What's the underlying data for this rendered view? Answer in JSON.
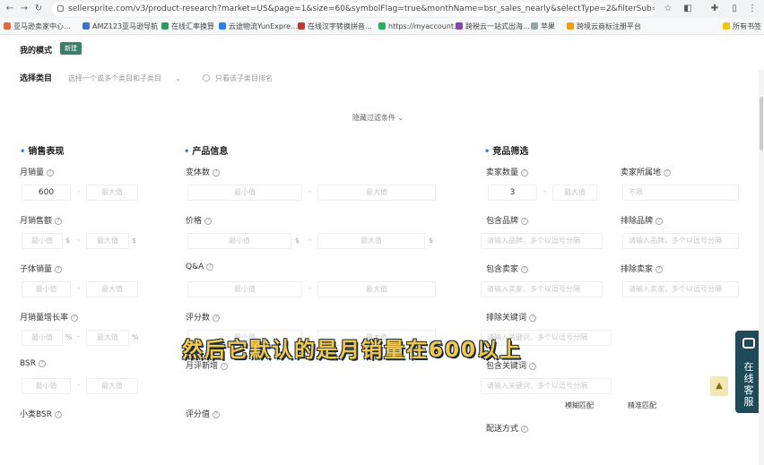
{
  "browser": {
    "url": "sellersprite.com/v3/product-research?market=US&page=1&size=60&symbolFlag=true&monthName=bsr_sales_nearly&selectType=2&filterSub=false&weightUnit=...",
    "all_bookmarks": "所有书签",
    "bookmarks": [
      "亚马逊卖家中心…",
      "AMZ123亚马逊导航",
      "在线汇率换算",
      "云途物流YunExpre…",
      "在线汉字转换拼音…",
      "https://myaccount…",
      "跨税云一站式出海…",
      "苹果",
      "跨境云商标注册平台"
    ]
  },
  "filters": {
    "mode_label": "我的模式",
    "mode_badge": "新建",
    "category_label": "选择类目",
    "category_placeholder": "选择一个或多个类目和子类目",
    "subcategory_label": "只看该子类目排名",
    "hide_filters": "隐藏过滤条件"
  },
  "sections": {
    "sales": "销售表现",
    "product": "产品信息",
    "competition": "竞品筛选"
  },
  "fields": {
    "monthly_sales": "月销量",
    "monthly_revenue": "月销售额",
    "variant_sales": "子体销量",
    "sales_growth": "月销量增长率",
    "bsr": "BSR",
    "sub_bsr": "小类BSR",
    "variant_count": "变体数",
    "price": "价格",
    "qa": "Q&A",
    "rating_count": "评分数",
    "monthly_new_reviews": "月评新增",
    "rating_value": "评分值",
    "seller_count": "卖家数量",
    "seller_location": "卖家所属地",
    "include_brand": "包含品牌",
    "exclude_brand": "排除品牌",
    "include_seller": "包含卖家",
    "exclude_seller": "排除卖家",
    "exclude_keywords": "排除关键词",
    "include_keywords": "包含关键词",
    "fulfillment": "配送方式"
  },
  "values": {
    "monthly_sales_min": "600",
    "seller_count_min": "3"
  },
  "placeholders": {
    "min": "最小值",
    "max": "最大值",
    "unlimited": "不限",
    "brand_include": "请输入品牌，多个以逗号分隔",
    "brand_exclude": "请输入品牌，多个以逗号分隔",
    "seller_include": "请输入卖家，多个以逗号分隔",
    "seller_exclude": "请输入卖家，多个以逗号分隔",
    "keywords_exclude": "请输入关键词，多个以逗号分隔",
    "keywords_include": "请输入关键词，多个以逗号分隔"
  },
  "units": {
    "dollar": "$",
    "percent": "%"
  },
  "match": {
    "fuzzy": "模糊匹配",
    "exact": "精准匹配"
  },
  "subtitle": "然后它默认的是月销量在600以上",
  "float_panel": "在线客服",
  "colors": {
    "accent": "#2b7cff",
    "badge": "#3d7d6a",
    "subtitle": "#f2c94c",
    "float": "#1f4a5a"
  }
}
